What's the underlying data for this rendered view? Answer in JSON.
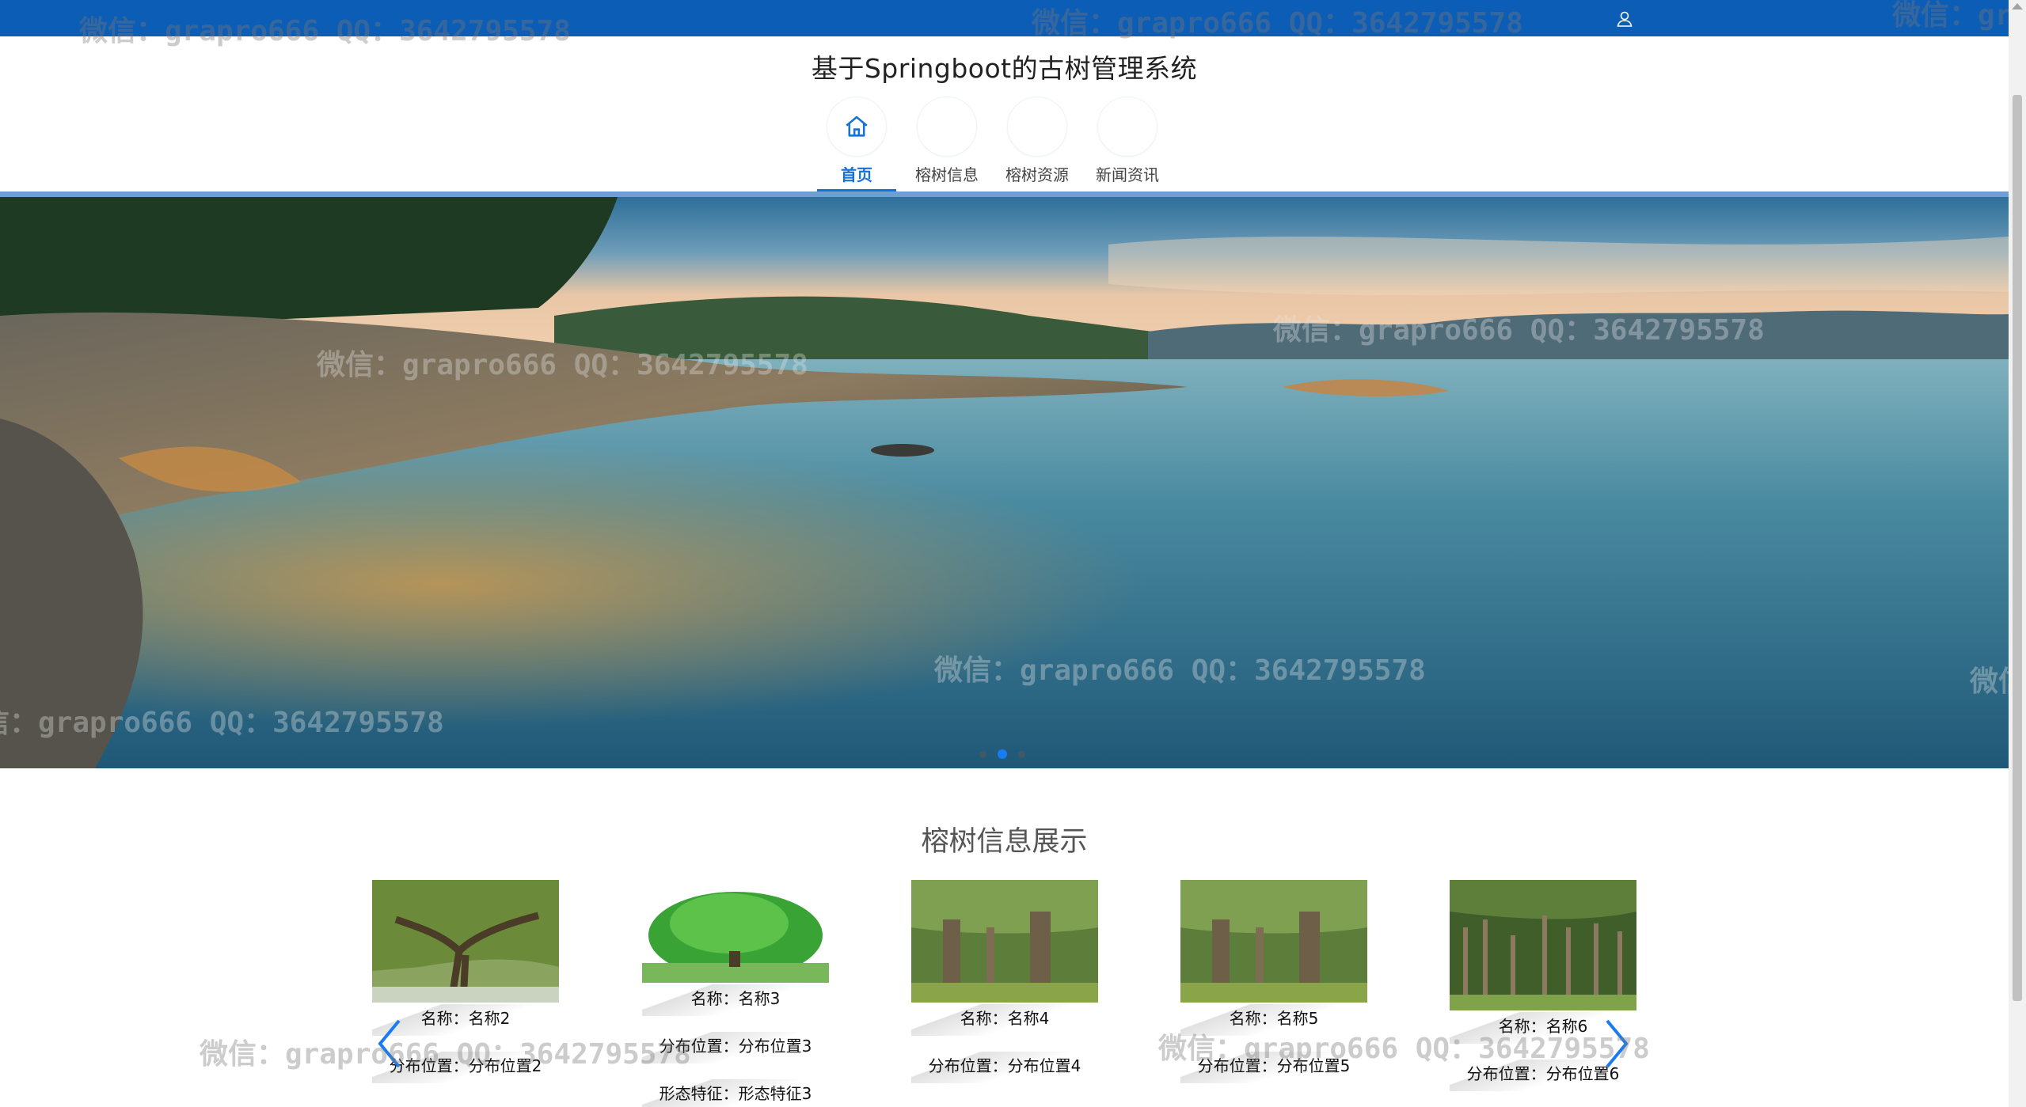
{
  "header": {
    "site_title": "基于Springboot的古树管理系统",
    "user_icon": "user-icon",
    "bar_color": "#0c5db5"
  },
  "nav": {
    "items": [
      {
        "label": "首页",
        "icon": "home-icon",
        "active": true
      },
      {
        "label": "榕树信息",
        "active": false
      },
      {
        "label": "榕树资源",
        "active": false
      },
      {
        "label": "新闻资讯",
        "active": false
      }
    ],
    "accent": "#1672d6"
  },
  "carousel": {
    "slide_count": 3,
    "active_index": 1
  },
  "section": {
    "title": "榕树信息展示",
    "cards": [
      {
        "name": "名称：名称2",
        "location": "分布位置：分布位置2"
      },
      {
        "name": "名称：名称3",
        "location": "分布位置：分布位置3",
        "feature": "形态特征：形态特征3"
      },
      {
        "name": "名称：名称4",
        "location": "分布位置：分布位置4"
      },
      {
        "name": "名称：名称5",
        "location": "分布位置：分布位置5"
      },
      {
        "name": "名称：名称6",
        "location": "分布位置：分布位置6"
      }
    ],
    "prev_icon": "chevron-left-icon",
    "next_icon": "chevron-right-icon"
  },
  "watermark": "微信：grapro666 QQ：3642795578"
}
